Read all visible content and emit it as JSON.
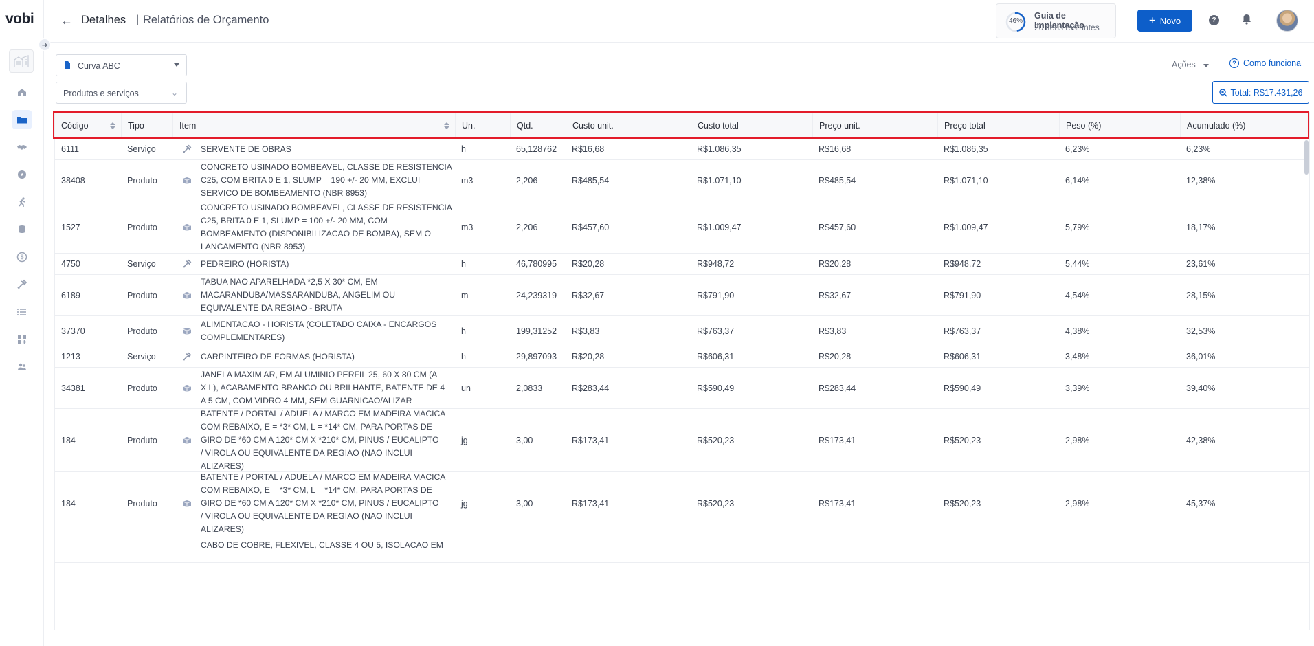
{
  "app": {
    "logo": "vobi"
  },
  "sidebar": {
    "collapse_icon": "arrow-right-icon",
    "items": [
      {
        "icon": "home-icon"
      },
      {
        "icon": "folder-icon",
        "active": true
      },
      {
        "icon": "handshake-icon"
      },
      {
        "icon": "compass-icon"
      },
      {
        "icon": "person-running-icon"
      },
      {
        "icon": "coins-icon"
      },
      {
        "icon": "dollar-icon"
      },
      {
        "icon": "tools-icon"
      },
      {
        "icon": "list-icon"
      },
      {
        "icon": "grid-plus-icon"
      },
      {
        "icon": "users-icon"
      }
    ]
  },
  "header": {
    "back_icon": "arrow-left-icon",
    "breadcrumb_1": "Detalhes",
    "separator": "|",
    "breadcrumb_2": "Relatórios de Orçamento",
    "guide": {
      "percent": "46%",
      "progress": 0.46,
      "title": "Guia de Implantação",
      "subtitle": "20 itens restantes"
    },
    "new_button": "Novo",
    "help_label": "?"
  },
  "controls": {
    "report_select": "Curva ABC",
    "filter_select": "Produtos e serviços",
    "actions": "Ações",
    "how_it_works": "Como funciona",
    "total": "Total: R$17.431,26"
  },
  "table": {
    "columns": [
      "Código",
      "Tipo",
      "Item",
      "Un.",
      "Qtd.",
      "Custo unit.",
      "Custo total",
      "Preço unit.",
      "Preço total",
      "Peso (%)",
      "Acumulado (%)"
    ],
    "rows": [
      {
        "codigo": "6111",
        "tipo": "Serviço",
        "icon": "tools-icon",
        "item": "SERVENTE DE OBRAS",
        "un": "h",
        "qtd": "65,128762",
        "custo_unit": "R$16,68",
        "custo_total": "R$1.086,35",
        "preco_unit": "R$16,68",
        "preco_total": "R$1.086,35",
        "peso": "6,23%",
        "acumulado": "6,23%"
      },
      {
        "codigo": "38408",
        "tipo": "Produto",
        "icon": "box-icon",
        "item": "CONCRETO USINADO BOMBEAVEL, CLASSE DE RESISTENCIA\nC25, COM BRITA 0 E 1, SLUMP = 190 +/- 20 MM, EXCLUI\nSERVICO DE BOMBEAMENTO (NBR 8953)",
        "un": "m3",
        "qtd": "2,206",
        "custo_unit": "R$485,54",
        "custo_total": "R$1.071,10",
        "preco_unit": "R$485,54",
        "preco_total": "R$1.071,10",
        "peso": "6,14%",
        "acumulado": "12,38%"
      },
      {
        "codigo": "1527",
        "tipo": "Produto",
        "icon": "box-icon",
        "item": "CONCRETO USINADO BOMBEAVEL, CLASSE DE RESISTENCIA\nC25, BRITA 0 E 1, SLUMP = 100 +/- 20 MM, COM\nBOMBEAMENTO (DISPONIBILIZACAO DE BOMBA), SEM O\nLANCAMENTO (NBR 8953)",
        "un": "m3",
        "qtd": "2,206",
        "custo_unit": "R$457,60",
        "custo_total": "R$1.009,47",
        "preco_unit": "R$457,60",
        "preco_total": "R$1.009,47",
        "peso": "5,79%",
        "acumulado": "18,17%"
      },
      {
        "codigo": "4750",
        "tipo": "Serviço",
        "icon": "tools-icon",
        "item": "PEDREIRO (HORISTA)",
        "un": "h",
        "qtd": "46,780995",
        "custo_unit": "R$20,28",
        "custo_total": "R$948,72",
        "preco_unit": "R$20,28",
        "preco_total": "R$948,72",
        "peso": "5,44%",
        "acumulado": "23,61%"
      },
      {
        "codigo": "6189",
        "tipo": "Produto",
        "icon": "box-icon",
        "item": "TABUA NAO APARELHADA *2,5 X 30* CM, EM\nMACARANDUBA/MASSARANDUBA, ANGELIM OU\nEQUIVALENTE DA REGIAO - BRUTA",
        "un": "m",
        "qtd": "24,239319",
        "custo_unit": "R$32,67",
        "custo_total": "R$791,90",
        "preco_unit": "R$32,67",
        "preco_total": "R$791,90",
        "peso": "4,54%",
        "acumulado": "28,15%"
      },
      {
        "codigo": "37370",
        "tipo": "Produto",
        "icon": "box-icon",
        "item": "ALIMENTACAO - HORISTA (COLETADO CAIXA - ENCARGOS\nCOMPLEMENTARES)",
        "un": "h",
        "qtd": "199,31252",
        "custo_unit": "R$3,83",
        "custo_total": "R$763,37",
        "preco_unit": "R$3,83",
        "preco_total": "R$763,37",
        "peso": "4,38%",
        "acumulado": "32,53%"
      },
      {
        "codigo": "1213",
        "tipo": "Serviço",
        "icon": "tools-icon",
        "item": "CARPINTEIRO DE FORMAS (HORISTA)",
        "un": "h",
        "qtd": "29,897093",
        "custo_unit": "R$20,28",
        "custo_total": "R$606,31",
        "preco_unit": "R$20,28",
        "preco_total": "R$606,31",
        "peso": "3,48%",
        "acumulado": "36,01%"
      },
      {
        "codigo": "34381",
        "tipo": "Produto",
        "icon": "box-icon",
        "item": "JANELA MAXIM AR, EM ALUMINIO PERFIL 25, 60 X 80 CM (A\nX L), ACABAMENTO BRANCO OU BRILHANTE, BATENTE DE 4\nA 5 CM, COM VIDRO 4 MM, SEM GUARNICAO/ALIZAR",
        "un": "un",
        "qtd": "2,0833",
        "custo_unit": "R$283,44",
        "custo_total": "R$590,49",
        "preco_unit": "R$283,44",
        "preco_total": "R$590,49",
        "peso": "3,39%",
        "acumulado": "39,40%"
      },
      {
        "codigo": "184",
        "tipo": "Produto",
        "icon": "box-icon",
        "item": "BATENTE / PORTAL / ADUELA / MARCO EM MADEIRA MACICA\nCOM REBAIXO, E = *3* CM, L = *14* CM, PARA PORTAS DE\nGIRO DE *60 CM A 120* CM X *210* CM, PINUS / EUCALIPTO\n/ VIROLA OU EQUIVALENTE DA REGIAO (NAO INCLUI\nALIZARES)",
        "un": "jg",
        "qtd": "3,00",
        "custo_unit": "R$173,41",
        "custo_total": "R$520,23",
        "preco_unit": "R$173,41",
        "preco_total": "R$520,23",
        "peso": "2,98%",
        "acumulado": "42,38%"
      },
      {
        "codigo": "184",
        "tipo": "Produto",
        "icon": "box-icon",
        "item": "BATENTE / PORTAL / ADUELA / MARCO EM MADEIRA MACICA\nCOM REBAIXO, E = *3* CM, L = *14* CM, PARA PORTAS DE\nGIRO DE *60 CM A 120* CM X *210* CM, PINUS / EUCALIPTO\n/ VIROLA OU EQUIVALENTE DA REGIAO (NAO INCLUI\nALIZARES)",
        "un": "jg",
        "qtd": "3,00",
        "custo_unit": "R$173,41",
        "custo_total": "R$520,23",
        "preco_unit": "R$173,41",
        "preco_total": "R$520,23",
        "peso": "2,98%",
        "acumulado": "45,37%"
      },
      {
        "codigo": "",
        "tipo": "",
        "icon": "",
        "item": "CABO DE COBRE, FLEXIVEL, CLASSE 4 OU 5, ISOLACAO EM",
        "un": "",
        "qtd": "",
        "custo_unit": "",
        "custo_total": "",
        "preco_unit": "",
        "preco_total": "",
        "peso": "",
        "acumulado": ""
      }
    ]
  }
}
